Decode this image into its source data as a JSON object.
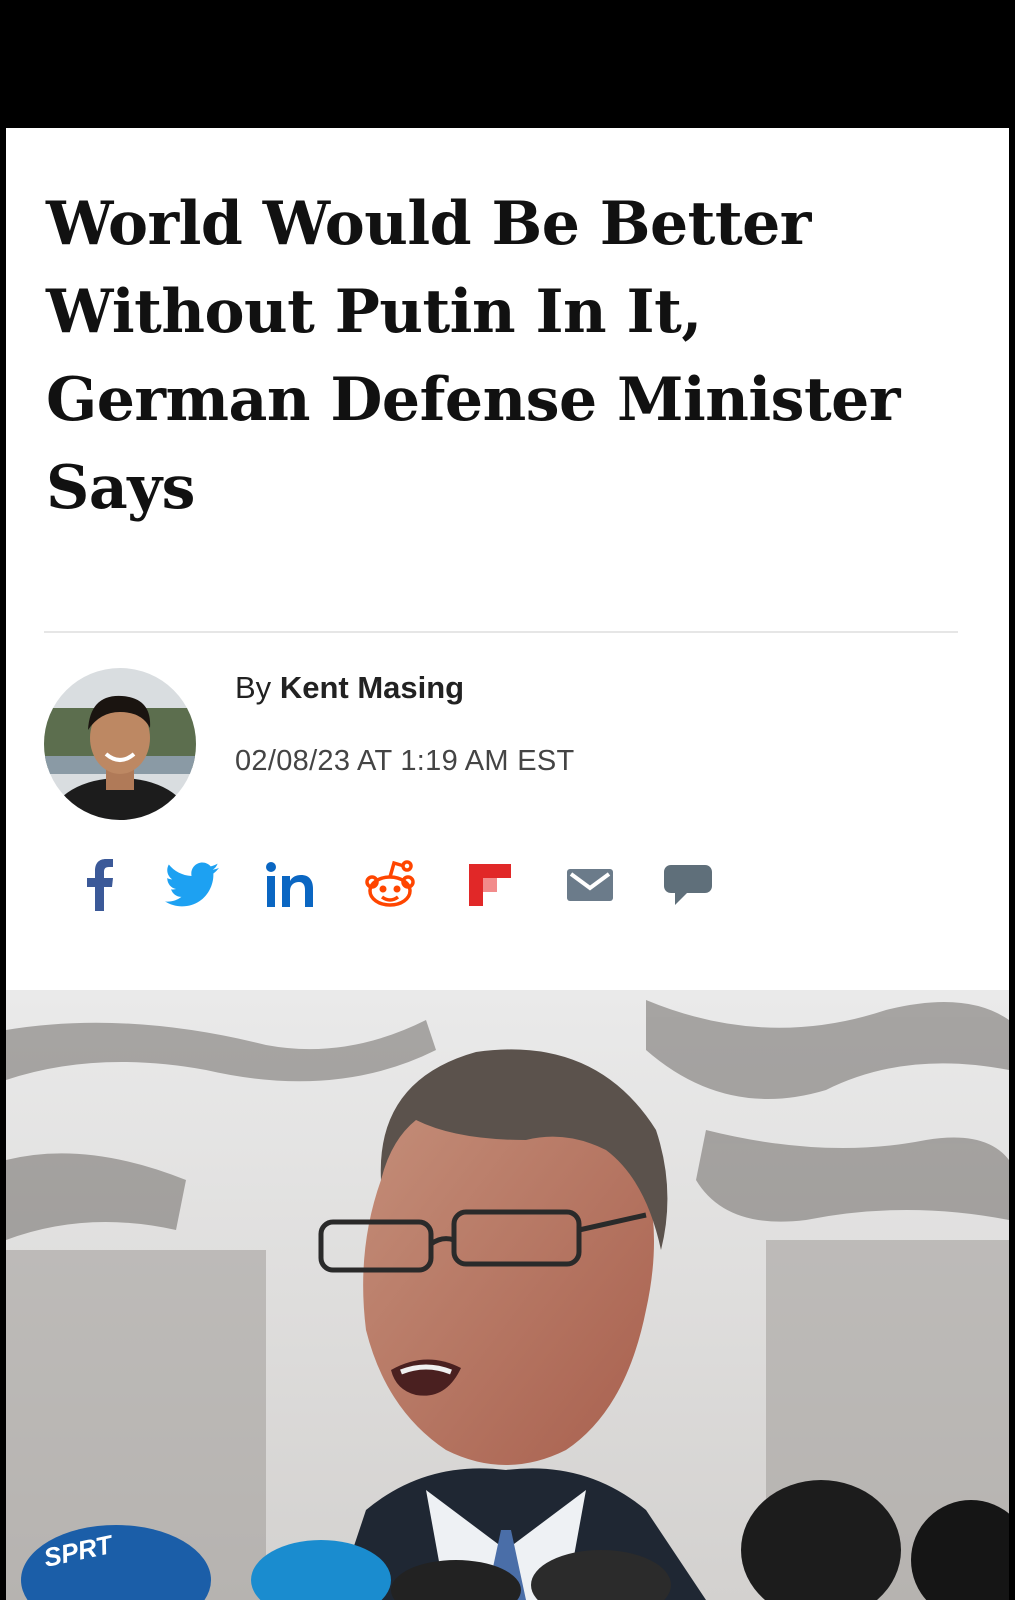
{
  "article": {
    "headline": "World Would Be Better Without Putin In It, German Defense Minister Says",
    "byline_prefix": "By",
    "author": "Kent Masing",
    "timestamp": "02/08/23 AT 1:19 AM EST"
  },
  "share": {
    "icons": [
      "facebook-icon",
      "twitter-icon",
      "linkedin-icon",
      "reddit-icon",
      "flipboard-icon",
      "email-icon",
      "comment-icon"
    ],
    "colors": {
      "facebook": "#3b5998",
      "twitter": "#1da1f2",
      "linkedin": "#0a66c2",
      "reddit": "#ff4500",
      "flipboard": "#e12828",
      "email": "#6b7b8a",
      "comment": "#5f6f7a"
    }
  },
  "photo": {
    "mic_label": "SPRT"
  }
}
